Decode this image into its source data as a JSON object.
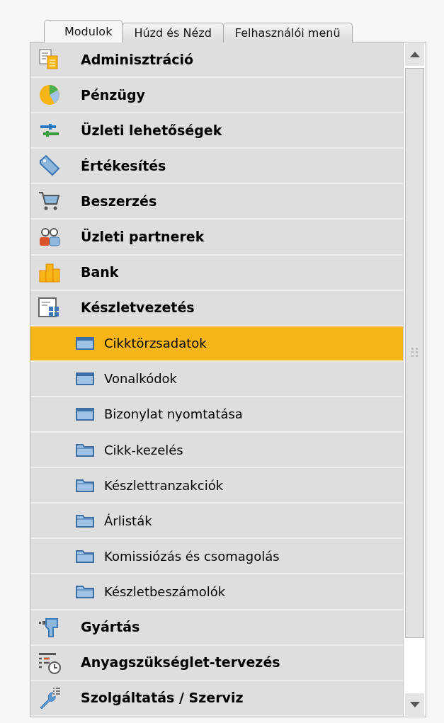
{
  "tabs": [
    {
      "label": "Modulok",
      "selected": true
    },
    {
      "label": "Húzd és Nézd",
      "selected": false
    },
    {
      "label": "Felhasználói menü",
      "selected": false
    }
  ],
  "modules": [
    {
      "label": "Adminisztráció"
    },
    {
      "label": "Pénzügy"
    },
    {
      "label": "Üzleti lehetőségek"
    },
    {
      "label": "Értékesítés"
    },
    {
      "label": "Beszerzés"
    },
    {
      "label": "Üzleti partnerek"
    },
    {
      "label": "Bank"
    },
    {
      "label": "Készletvezetés",
      "children": [
        {
          "label": "Cikktörzsadatok",
          "kind": "form",
          "selected": true
        },
        {
          "label": "Vonalkódok",
          "kind": "form",
          "selected": false
        },
        {
          "label": "Bizonylat nyomtatása",
          "kind": "form",
          "selected": false
        },
        {
          "label": "Cikk-kezelés",
          "kind": "folder",
          "selected": false
        },
        {
          "label": "Készlettranzakciók",
          "kind": "folder",
          "selected": false
        },
        {
          "label": "Árlisták",
          "kind": "folder",
          "selected": false
        },
        {
          "label": "Komissiózás és csomagolás",
          "kind": "folder",
          "selected": false
        },
        {
          "label": "Készletbeszámolók",
          "kind": "folder",
          "selected": false
        }
      ]
    },
    {
      "label": "Gyártás"
    },
    {
      "label": "Anyagszükséglet-tervezés"
    },
    {
      "label": "Szolgáltatás / Szerviz"
    }
  ]
}
